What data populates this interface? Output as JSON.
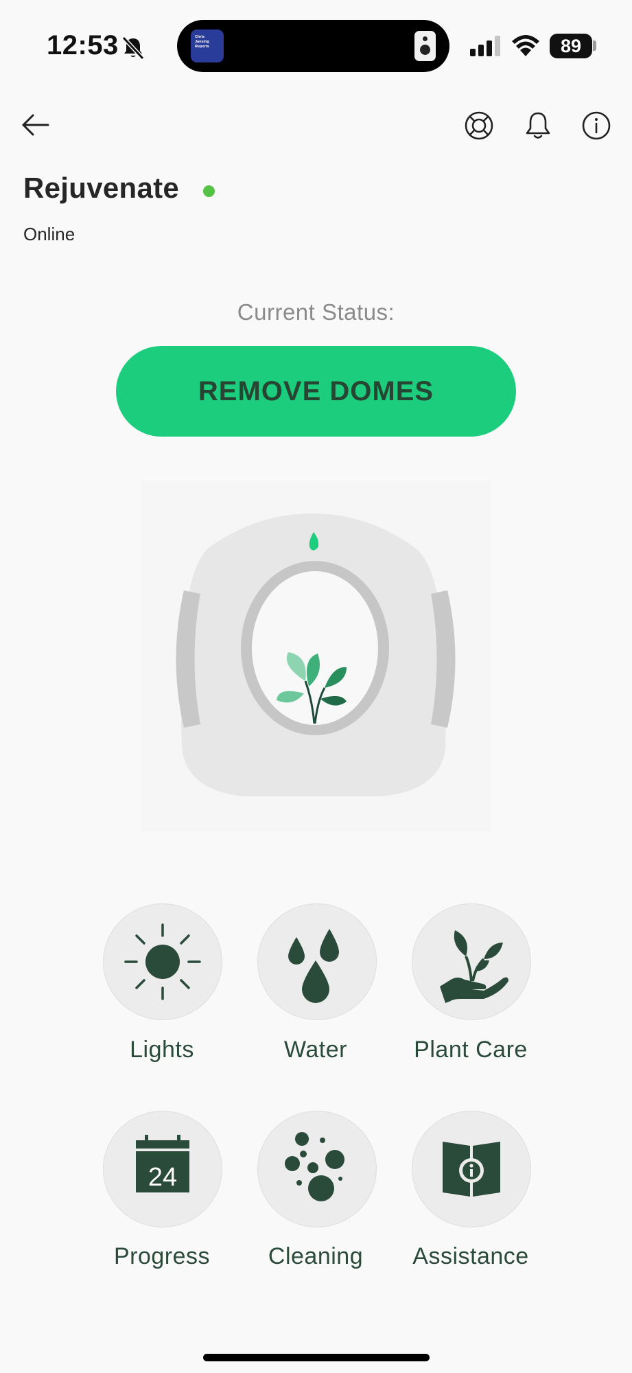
{
  "status_bar": {
    "time": "12:53",
    "battery": "89",
    "island_app_text": "Chris\nJansing\nReports"
  },
  "header": {
    "back_icon": "arrow-left-icon",
    "actions": [
      "lifebuoy-icon",
      "bell-icon",
      "info-icon"
    ]
  },
  "device": {
    "name": "Rejuvenate",
    "connection": "Online",
    "online_color": "#56c245"
  },
  "status": {
    "label": "Current Status:",
    "value": "REMOVE DOMES",
    "color": "#1ccd7e"
  },
  "menu": [
    {
      "label": "Lights",
      "icon": "sun-icon"
    },
    {
      "label": "Water",
      "icon": "water-drops-icon"
    },
    {
      "label": "Plant Care",
      "icon": "plant-hand-icon"
    },
    {
      "label": "Progress",
      "icon": "calendar-icon",
      "calendar_day": "24"
    },
    {
      "label": "Cleaning",
      "icon": "bubbles-icon"
    },
    {
      "label": "Assistance",
      "icon": "info-book-icon"
    }
  ],
  "colors": {
    "accent": "#1ccd7e",
    "icon": "#2a4a3a",
    "tile_bg": "#ececec"
  }
}
